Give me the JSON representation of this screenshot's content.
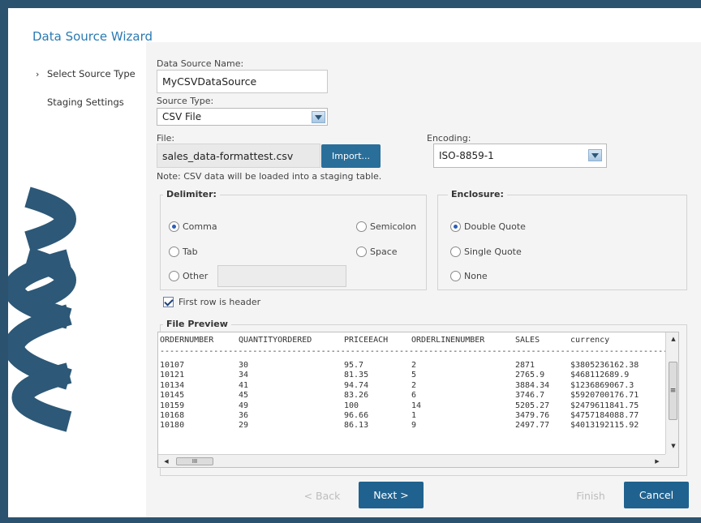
{
  "wizard": {
    "title": "Data Source Wizard",
    "nav": [
      {
        "label": "Select Source Type",
        "active": true
      },
      {
        "label": "Staging Settings",
        "active": false
      }
    ]
  },
  "form": {
    "name_label": "Data Source Name:",
    "name_value": "MyCSVDataSource",
    "type_label": "Source Type:",
    "type_value": "CSV File",
    "file_label": "File:",
    "file_value": "sales_data-formattest.csv",
    "import_label": "Import...",
    "encoding_label": "Encoding:",
    "encoding_value": "ISO-8859-1",
    "note": "Note: CSV data will be loaded into a staging table."
  },
  "delimiter": {
    "title": "Delimiter:",
    "options": {
      "comma": "Comma",
      "semicolon": "Semicolon",
      "tab": "Tab",
      "space": "Space",
      "other": "Other"
    },
    "selected": "Comma",
    "other_value": ""
  },
  "enclosure": {
    "title": "Enclosure:",
    "options": {
      "double": "Double Quote",
      "single": "Single Quote",
      "none": "None"
    },
    "selected": "Double Quote"
  },
  "header_checkbox": {
    "label": "First row is header",
    "checked": true
  },
  "preview": {
    "title": "File Preview",
    "columns": [
      "ORDERNUMBER",
      "QUANTITYORDERED",
      "PRICEEACH",
      "ORDERLINENUMBER",
      "SALES",
      "currency"
    ],
    "separator": "----------------------------------------------------------------------------------------------------------------",
    "rows": [
      [
        "10107",
        "30",
        "95.7",
        "2",
        "2871",
        "$3805236162.38"
      ],
      [
        "10121",
        "34",
        "81.35",
        "5",
        "2765.9",
        "$468112689.9"
      ],
      [
        "10134",
        "41",
        "94.74",
        "2",
        "3884.34",
        "$1236869067.3"
      ],
      [
        "10145",
        "45",
        "83.26",
        "6",
        "3746.7",
        "$5920700176.71"
      ],
      [
        "10159",
        "49",
        "100",
        "14",
        "5205.27",
        "$2479611841.75"
      ],
      [
        "10168",
        "36",
        "96.66",
        "1",
        "3479.76",
        "$4757184088.77"
      ],
      [
        "10180",
        "29",
        "86.13",
        "9",
        "2497.77",
        "$4013192115.92"
      ]
    ]
  },
  "scrollbar": {
    "up": "▲",
    "down": "▼",
    "left": "◀",
    "right": "▶",
    "v_grip": "≡",
    "h_grip": "III"
  },
  "footer": {
    "back": "< Back",
    "next": "Next >",
    "finish": "Finish",
    "cancel": "Cancel"
  },
  "colors": {
    "frame": "#2b5370",
    "accent_blue": "#2a7ab3",
    "primary_button": "#20628f",
    "panel_bg": "#f4f4f4"
  }
}
